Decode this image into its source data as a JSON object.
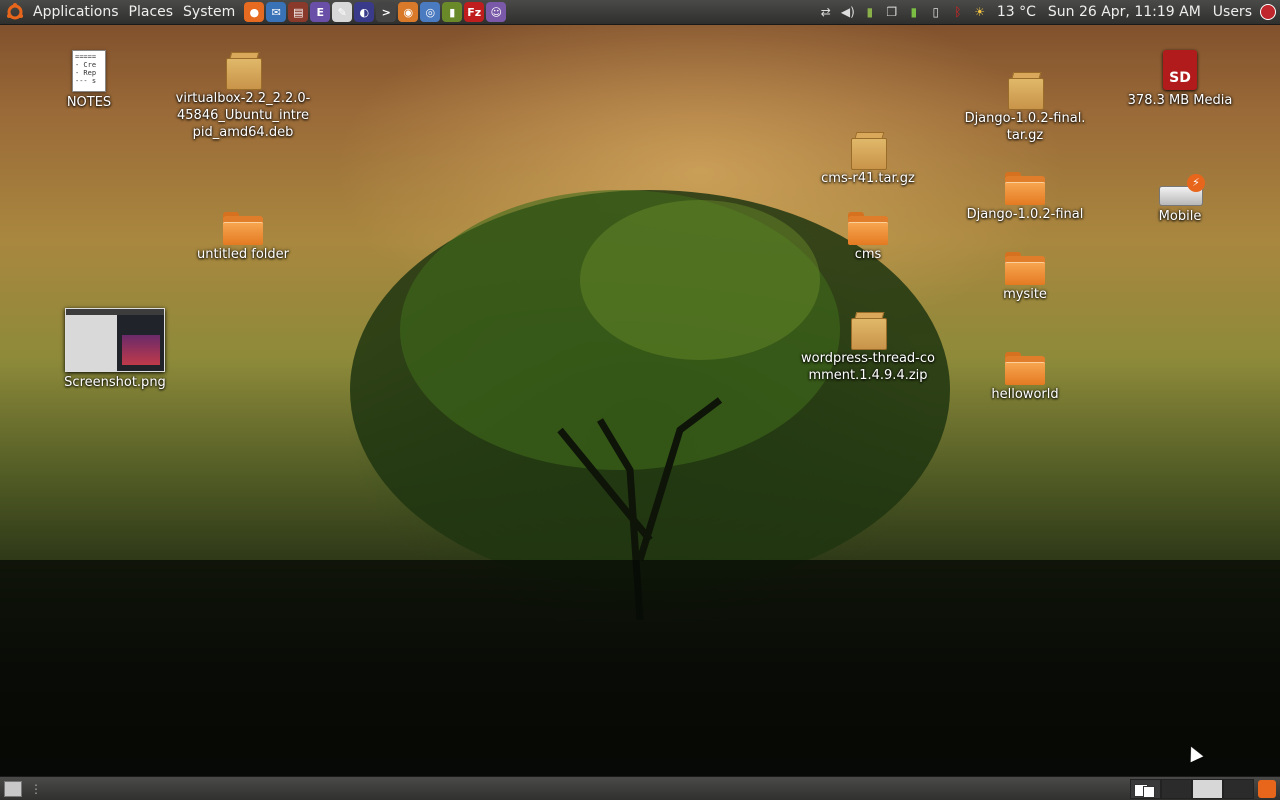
{
  "top_panel": {
    "menus": [
      "Applications",
      "Places",
      "System"
    ],
    "launchers": [
      {
        "icon": "firefox-icon",
        "color": "#e66a1f",
        "glyph": "●"
      },
      {
        "icon": "thunderbird-icon",
        "color": "#3a72b8",
        "glyph": "✉"
      },
      {
        "icon": "monitor-icon",
        "color": "#8a3a2a",
        "glyph": "▤"
      },
      {
        "icon": "emacs-icon",
        "color": "#6a4fa8",
        "glyph": "E"
      },
      {
        "icon": "text-editor-icon",
        "color": "#d8d8d8",
        "glyph": "✎"
      },
      {
        "icon": "eclipse-icon",
        "color": "#3a3a8a",
        "glyph": "◐"
      },
      {
        "icon": "terminal-icon",
        "color": "#444444",
        "glyph": ">"
      },
      {
        "icon": "screenshot-icon",
        "color": "#d97a2a",
        "glyph": "◉"
      },
      {
        "icon": "browser-icon",
        "color": "#4a7ac0",
        "glyph": "◎"
      },
      {
        "icon": "book-icon",
        "color": "#6a8a2a",
        "glyph": "▮"
      },
      {
        "icon": "filezilla-icon",
        "color": "#c01e1e",
        "glyph": "Fz"
      },
      {
        "icon": "pidgin-icon",
        "color": "#7a5aa8",
        "glyph": "☺"
      }
    ],
    "temperature": "13 °C",
    "datetime": "Sun 26 Apr, 11:19 AM",
    "users_label": "Users"
  },
  "desktop": {
    "notes_preview": "=====\n- Cre\n- Rep\n--- s",
    "icons": {
      "notes": "NOTES",
      "virtualbox": "virtualbox-2.2_2.2.0-45846_Ubuntu_intrepid_amd64.deb",
      "untitled": "untitled folder",
      "screenshot": "Screenshot.png",
      "cms_tar": "cms-r41.tar.gz",
      "cms": "cms",
      "wordpress": "wordpress-thread-comment.1.4.9.4.zip",
      "django_tar": "Django-1.0.2-final.tar.gz",
      "django": "Django-1.0.2-final",
      "mysite": "mysite",
      "helloworld": "helloworld",
      "media": "378.3 MB Media",
      "mobile": "Mobile",
      "sd_label": "SD"
    }
  },
  "colors": {
    "folder_orange": "#e47a22",
    "panel": "#3a3a38"
  }
}
